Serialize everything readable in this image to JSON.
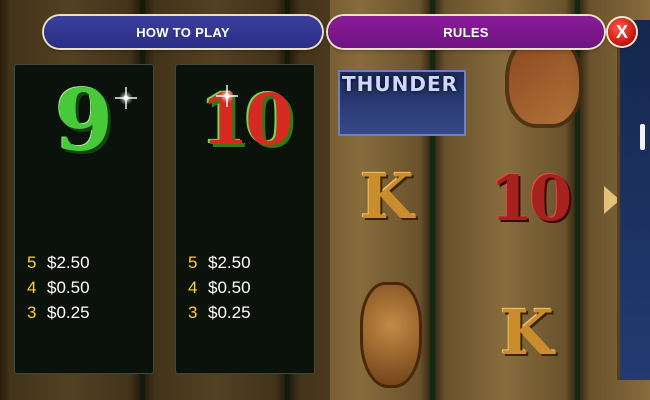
{
  "tabs": {
    "how_to_play": "HOW TO PLAY",
    "rules": "RULES"
  },
  "close_label": "X",
  "background": {
    "banner_text": "THUNDER",
    "symbols": [
      "K",
      "10",
      "K"
    ]
  },
  "paytable": [
    {
      "symbol": "9",
      "symbol_color": "#47c93a",
      "pays": [
        {
          "count": "5",
          "amount": "$2.50"
        },
        {
          "count": "4",
          "amount": "$0.50"
        },
        {
          "count": "3",
          "amount": "$0.25"
        }
      ]
    },
    {
      "symbol": "10",
      "symbol_color": "#d52a22",
      "pays": [
        {
          "count": "5",
          "amount": "$2.50"
        },
        {
          "count": "4",
          "amount": "$0.50"
        },
        {
          "count": "3",
          "amount": "$0.25"
        }
      ]
    }
  ],
  "colors": {
    "how_to_play_button": "#2f339a",
    "rules_button": "#7a168a",
    "close_button": "#d3140c",
    "pay_count": "#ffd21c",
    "pay_amount": "#ffffff"
  }
}
